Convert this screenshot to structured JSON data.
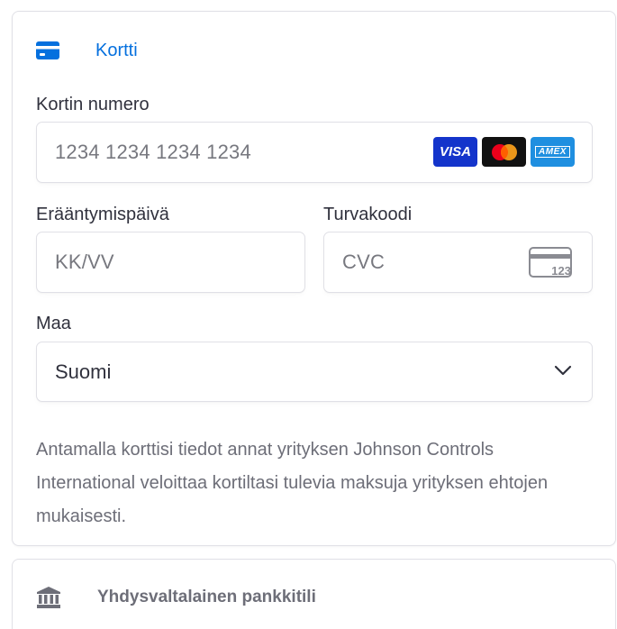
{
  "card_tab": {
    "title": "Kortti",
    "icon": "credit-card-icon",
    "accent_color": "#0570de"
  },
  "card_number": {
    "label": "Kortin numero",
    "placeholder": "1234 1234 1234 1234",
    "brands": [
      "VISA",
      "Mastercard",
      "AMEX"
    ]
  },
  "expiry": {
    "label": "Erääntymispäivä",
    "placeholder": "KK/VV"
  },
  "cvc": {
    "label": "Turvakoodi",
    "placeholder": "CVC",
    "icon_text": "123"
  },
  "country": {
    "label": "Maa",
    "value": "Suomi"
  },
  "terms_text": "Antamalla korttisi tiedot annat yrityksen Johnson Controls International veloittaa kortiltasi tulevia maksuja yrityksen ehtojen mukaisesti.",
  "bank_tab": {
    "title": "Yhdysvaltalainen pankkitili",
    "icon": "bank-icon"
  }
}
